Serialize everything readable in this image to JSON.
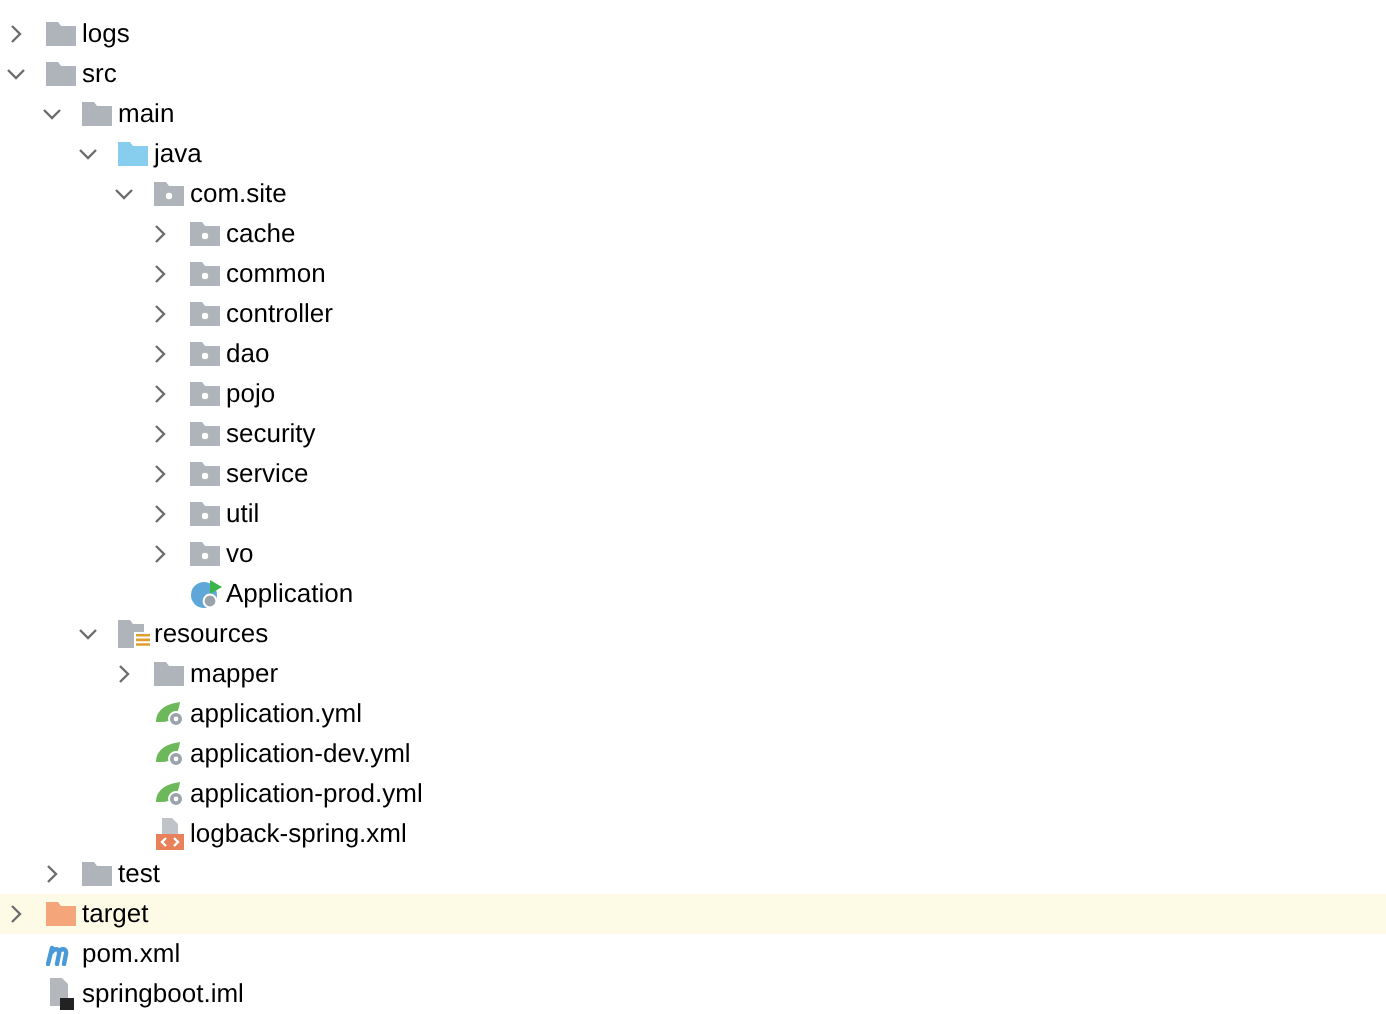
{
  "tree": [
    {
      "label": "logs",
      "kind": "folder",
      "expanded": false,
      "selected": false
    },
    {
      "label": "src",
      "kind": "folder",
      "expanded": true,
      "selected": false,
      "children": [
        {
          "label": "main",
          "kind": "folder",
          "expanded": true,
          "selected": false,
          "children": [
            {
              "label": "java",
              "kind": "source-folder",
              "expanded": true,
              "selected": false,
              "children": [
                {
                  "label": "com.site",
                  "kind": "package",
                  "expanded": true,
                  "selected": false,
                  "children": [
                    {
                      "label": "cache",
                      "kind": "package",
                      "expanded": false,
                      "selected": false
                    },
                    {
                      "label": "common",
                      "kind": "package",
                      "expanded": false,
                      "selected": false
                    },
                    {
                      "label": "controller",
                      "kind": "package",
                      "expanded": false,
                      "selected": false
                    },
                    {
                      "label": "dao",
                      "kind": "package",
                      "expanded": false,
                      "selected": false
                    },
                    {
                      "label": "pojo",
                      "kind": "package",
                      "expanded": false,
                      "selected": false
                    },
                    {
                      "label": "security",
                      "kind": "package",
                      "expanded": false,
                      "selected": false
                    },
                    {
                      "label": "service",
                      "kind": "package",
                      "expanded": false,
                      "selected": false
                    },
                    {
                      "label": "util",
                      "kind": "package",
                      "expanded": false,
                      "selected": false
                    },
                    {
                      "label": "vo",
                      "kind": "package",
                      "expanded": false,
                      "selected": false
                    },
                    {
                      "label": "Application",
                      "kind": "spring-class",
                      "selected": false
                    }
                  ]
                }
              ]
            },
            {
              "label": "resources",
              "kind": "resource-folder",
              "expanded": true,
              "selected": false,
              "children": [
                {
                  "label": "mapper",
                  "kind": "folder",
                  "expanded": false,
                  "selected": false
                },
                {
                  "label": "application.yml",
                  "kind": "spring-config",
                  "selected": false
                },
                {
                  "label": "application-dev.yml",
                  "kind": "spring-config",
                  "selected": false
                },
                {
                  "label": "application-prod.yml",
                  "kind": "spring-config",
                  "selected": false
                },
                {
                  "label": "logback-spring.xml",
                  "kind": "xml",
                  "selected": false
                }
              ]
            }
          ]
        },
        {
          "label": "test",
          "kind": "folder",
          "expanded": false,
          "selected": false
        }
      ]
    },
    {
      "label": "target",
      "kind": "excluded-folder",
      "expanded": false,
      "selected": true
    },
    {
      "label": "pom.xml",
      "kind": "maven",
      "selected": false
    },
    {
      "label": "springboot.iml",
      "kind": "module-file",
      "selected": false
    }
  ]
}
